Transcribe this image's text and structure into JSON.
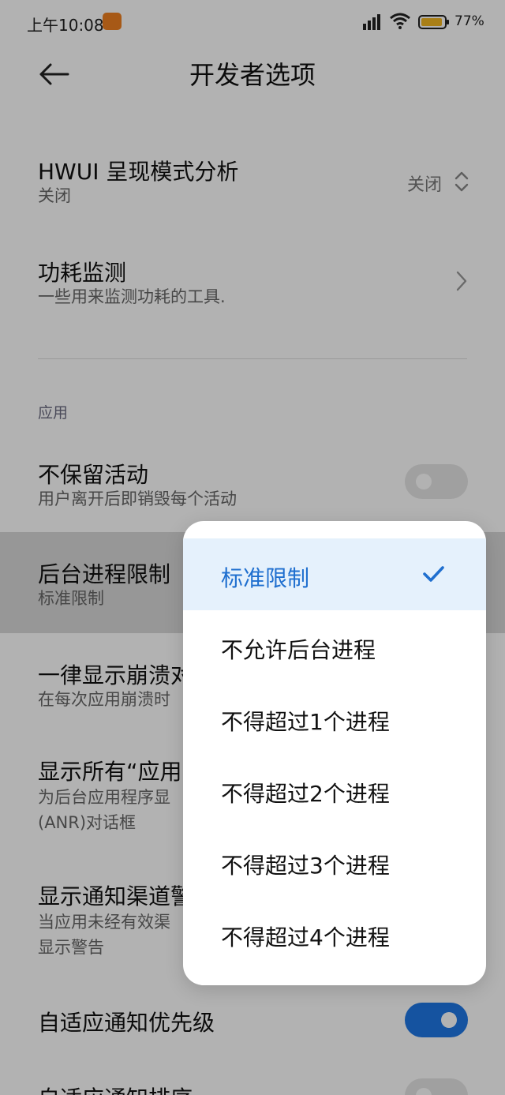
{
  "status": {
    "time": "上午10:08",
    "battery": "77%"
  },
  "header": {
    "title": "开发者选项"
  },
  "rows": {
    "hwui": {
      "title": "HWUI 呈现模式分析",
      "subtitle": "关闭",
      "value": "关闭"
    },
    "power": {
      "title": "功耗监测",
      "subtitle": "一些用来监测功耗的工具."
    },
    "section_label": "应用",
    "dont_keep": {
      "title": "不保留活动",
      "subtitle": "用户离开后即销毁每个活动",
      "enabled": false
    },
    "bg_limit": {
      "title": "后台进程限制",
      "subtitle": "标准限制"
    },
    "crash_dialog": {
      "title": "一律显示崩溃对",
      "subtitle": "在每次应用崩溃时"
    },
    "anr": {
      "title": "显示所有“应用",
      "subtitle1": "为后台应用程序显",
      "subtitle2": "(ANR)对话框"
    },
    "channel_warn": {
      "title": "显示通知渠道警",
      "subtitle1": "当应用未经有效渠",
      "subtitle2": "显示警告"
    },
    "adaptive_priority": {
      "title": "自适应通知优先级",
      "enabled": true
    },
    "adaptive_sort": {
      "title": "自适应通知排序",
      "enabled": false
    }
  },
  "popup": {
    "options": [
      {
        "label": "标准限制",
        "selected": true
      },
      {
        "label": "不允许后台进程",
        "selected": false
      },
      {
        "label": "不得超过1个进程",
        "selected": false
      },
      {
        "label": "不得超过2个进程",
        "selected": false
      },
      {
        "label": "不得超过3个进程",
        "selected": false
      },
      {
        "label": "不得超过4个进程",
        "selected": false
      }
    ]
  },
  "colors": {
    "accent": "#1f78e6",
    "selected_text": "#1f6fcf",
    "selected_bg": "#e5f1fc"
  }
}
